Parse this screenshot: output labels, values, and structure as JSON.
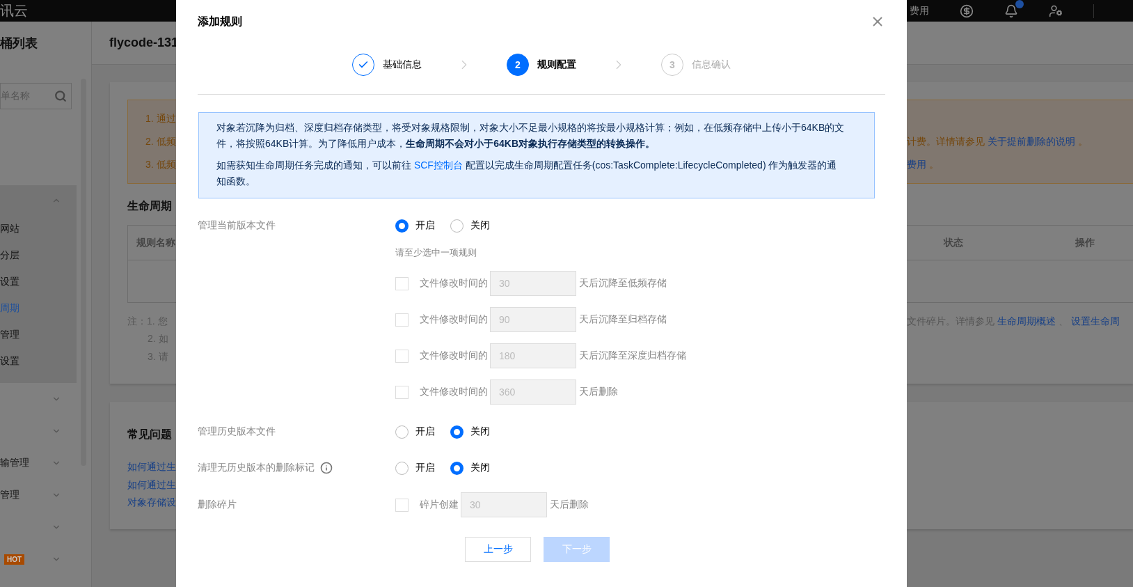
{
  "top_bar": {
    "brand": "讯云",
    "links": [
      "费用"
    ]
  },
  "sidebar": {
    "title": "桶列表",
    "search": {
      "placeholder": "单名称"
    },
    "menu": [
      {
        "expanded": true,
        "children": [
          {
            "label": "网站",
            "selected": false
          },
          {
            "label": "分层",
            "selected": false
          },
          {
            "label": "设置",
            "selected": false
          },
          {
            "label": "周期",
            "selected": true
          },
          {
            "label": "管理",
            "selected": false
          },
          {
            "label": "设置",
            "selected": false
          }
        ]
      },
      {
        "expanded": false
      },
      {
        "expanded": false
      },
      {
        "label": "输管理",
        "expanded": false
      },
      {
        "label": "管理",
        "expanded": false
      },
      {
        "expanded": false
      },
      {
        "badge": "HOT",
        "expanded": false
      }
    ]
  },
  "main": {
    "bucket_title": "flycode-131",
    "notice": [
      {
        "left": "1. 通过"
      },
      {
        "left": "2. 低频",
        "right": [
          {
            "kind": "text",
            "text": "计费。详情请参见 "
          },
          {
            "kind": "link",
            "text": "关于提前删除的说明"
          },
          {
            "kind": "text",
            "text": " 。"
          }
        ]
      },
      {
        "left": "3. 低频",
        "right": [
          {
            "kind": "link",
            "text": "费用"
          },
          {
            "kind": "text",
            "text": " 。"
          }
        ]
      }
    ],
    "lifecycle": {
      "title": "生命周期",
      "columns_left": [
        "规则名称"
      ],
      "columns_right": [
        "状态",
        "操作"
      ],
      "notes": [
        {
          "left": "注：1. 您",
          "right": [
            {
              "kind": "text",
              "text": "文件碎片。详情参见 "
            },
            {
              "kind": "link",
              "text": "生命周期概述"
            },
            {
              "kind": "text",
              "text": " 、 "
            },
            {
              "kind": "link",
              "text": "设置生命周"
            }
          ]
        },
        {
          "left": "2. 如"
        },
        {
          "left": "3. 请"
        }
      ]
    },
    "faq": {
      "title": "常见问题",
      "links": [
        "如何通过生",
        "如何通过生",
        "对象存储设"
      ]
    }
  },
  "modal": {
    "title": "添加规则",
    "steps": [
      {
        "label": "基础信息",
        "completed": true,
        "selected": false
      },
      {
        "number": "2",
        "label": "规则配置",
        "completed": false,
        "selected": true
      },
      {
        "number": "3",
        "label": "信息确认",
        "completed": false,
        "selected": false
      }
    ],
    "notice": {
      "paragraph": "对象若沉降为归档、深度归档存储类型，将受对象规格限制，对象大小不足最小规格的将按最小规格计算；例如，在低频存储中上传小于64KB的文件，将按照64KB计算。为了降低用户成本，**生命周期不会对小于64KB对象执行存储类型的转换操作。**",
      "parts": [
        {
          "kind": "text",
          "text": "如需获知生命周期任务完成的通知，可以前往 "
        },
        {
          "kind": "link",
          "text": "SCF控制台"
        },
        {
          "kind": "text",
          "text": " 配置以完成生命周期配置任务(cos:TaskComplete:LifecycleCompleted) 作为触发器的通知函数。"
        }
      ]
    },
    "rows": [
      {
        "kind": "radio",
        "label": "管理当前版本文件",
        "options": [
          {
            "label": "开启",
            "selected": true
          },
          {
            "label": "关闭",
            "selected": false
          }
        ],
        "hint": "请至少选中一项规则",
        "rules": [
          {
            "checked": false,
            "prefix": "文件修改时间的",
            "value": "30",
            "suffix": "天后沉降至低频存储"
          },
          {
            "checked": false,
            "prefix": "文件修改时间的",
            "value": "90",
            "suffix": "天后沉降至归档存储"
          },
          {
            "checked": false,
            "prefix": "文件修改时间的",
            "value": "180",
            "suffix": "天后沉降至深度归档存储"
          },
          {
            "checked": false,
            "prefix": "文件修改时间的",
            "value": "360",
            "suffix": "天后删除"
          }
        ]
      },
      {
        "kind": "radio",
        "label": "管理历史版本文件",
        "options": [
          {
            "label": "开启",
            "selected": false
          },
          {
            "label": "关闭",
            "selected": true
          }
        ]
      },
      {
        "kind": "radio",
        "label": "清理无历史版本的删除标记",
        "info": true,
        "options": [
          {
            "label": "开启",
            "selected": false
          },
          {
            "label": "关闭",
            "selected": true
          }
        ]
      },
      {
        "kind": "checkbox",
        "label": "删除碎片",
        "rule": {
          "checked": false,
          "prefix": "碎片创建",
          "value": "30",
          "suffix": "天后删除"
        }
      }
    ],
    "buttons": {
      "prev": {
        "label": "上一步"
      },
      "next": {
        "label": "下一步",
        "disabled": true
      }
    }
  }
}
